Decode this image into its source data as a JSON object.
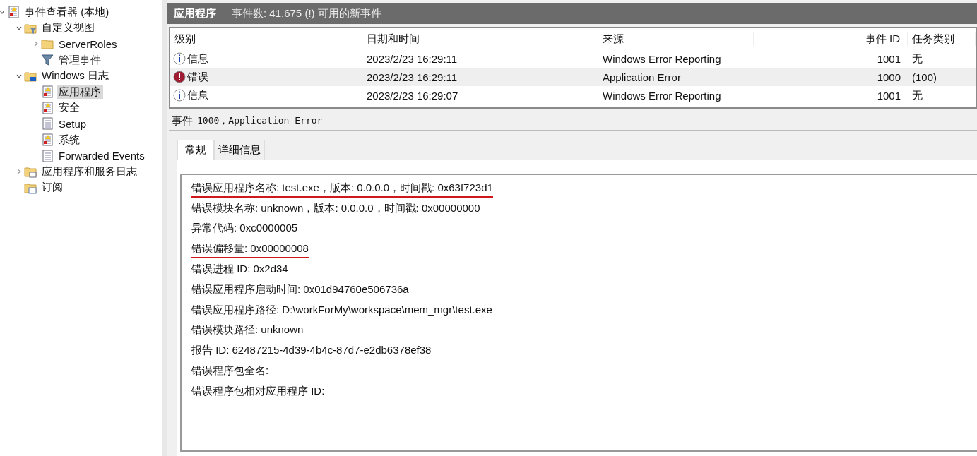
{
  "tree": [
    {
      "label": "事件查看器 (本地)",
      "kind": "viewer",
      "has_children": true,
      "expanded": true,
      "selected": false,
      "children": [
        {
          "label": "自定义视图",
          "kind": "folder-filter",
          "has_children": true,
          "expanded": true,
          "selected": false,
          "children": [
            {
              "label": "ServerRoles",
              "kind": "folder",
              "has_children": true,
              "expanded": false,
              "selected": false
            },
            {
              "label": "管理事件",
              "kind": "filter",
              "selected": false
            }
          ]
        },
        {
          "label": "Windows 日志",
          "kind": "folder-windows",
          "has_children": true,
          "expanded": true,
          "selected": false,
          "children": [
            {
              "label": "应用程序",
              "kind": "log-warn",
              "selected": true
            },
            {
              "label": "安全",
              "kind": "log-warn",
              "selected": false
            },
            {
              "label": "Setup",
              "kind": "log",
              "selected": false
            },
            {
              "label": "系统",
              "kind": "log-warn",
              "selected": false
            },
            {
              "label": "Forwarded Events",
              "kind": "log",
              "selected": false
            }
          ]
        },
        {
          "label": "应用程序和服务日志",
          "kind": "folder-app",
          "has_children": true,
          "expanded": false,
          "selected": false
        },
        {
          "label": "订阅",
          "kind": "subscription",
          "selected": false
        }
      ]
    }
  ],
  "header": {
    "title": "应用程序",
    "info": "事件数: 41,675 (!) 可用的新事件"
  },
  "table": {
    "columns": [
      "级别",
      "日期和时间",
      "来源",
      "事件 ID",
      "任务类别"
    ],
    "rows": [
      {
        "kind": "info",
        "level": "信息",
        "datetime": "2023/2/23 16:29:11",
        "source": "Windows Error Reporting",
        "event_id": "1001",
        "category": "无",
        "selected": false
      },
      {
        "kind": "error",
        "level": "错误",
        "datetime": "2023/2/23 16:29:11",
        "source": "Application Error",
        "event_id": "1000",
        "category": "(100)",
        "selected": true
      },
      {
        "kind": "info",
        "level": "信息",
        "datetime": "2023/2/23 16:29:07",
        "source": "Windows Error Reporting",
        "event_id": "1001",
        "category": "无",
        "selected": false
      }
    ]
  },
  "event": {
    "title_prefix": "事件",
    "title": "1000，Application Error",
    "tabs": [
      {
        "label": "常规",
        "selected": true
      },
      {
        "label": "详细信息",
        "selected": false
      }
    ],
    "lines": [
      {
        "text": "错误应用程序名称: test.exe，版本: 0.0.0.0，时间戳: 0x63f723d1",
        "underlined": true
      },
      {
        "text": "错误模块名称: unknown，版本: 0.0.0.0，时间戳: 0x00000000",
        "underlined": false
      },
      {
        "text": "异常代码: 0xc0000005",
        "underlined": false
      },
      {
        "text": "错误偏移量: 0x00000008",
        "underlined": true
      },
      {
        "text": "错误进程 ID: 0x2d34",
        "underlined": false
      },
      {
        "text": "错误应用程序启动时间: 0x01d94760e506736a",
        "underlined": false
      },
      {
        "text": "错误应用程序路径: D:\\workForMy\\workspace\\mem_mgr\\test.exe",
        "underlined": false
      },
      {
        "text": "错误模块路径: unknown",
        "underlined": false
      },
      {
        "text": "报告 ID: 62487215-4d39-4b4c-87d7-e2db6378ef38",
        "underlined": false
      },
      {
        "text": "错误程序包全名:",
        "underlined": false
      },
      {
        "text": "错误程序包相对应用程序 ID:",
        "underlined": false
      }
    ]
  }
}
